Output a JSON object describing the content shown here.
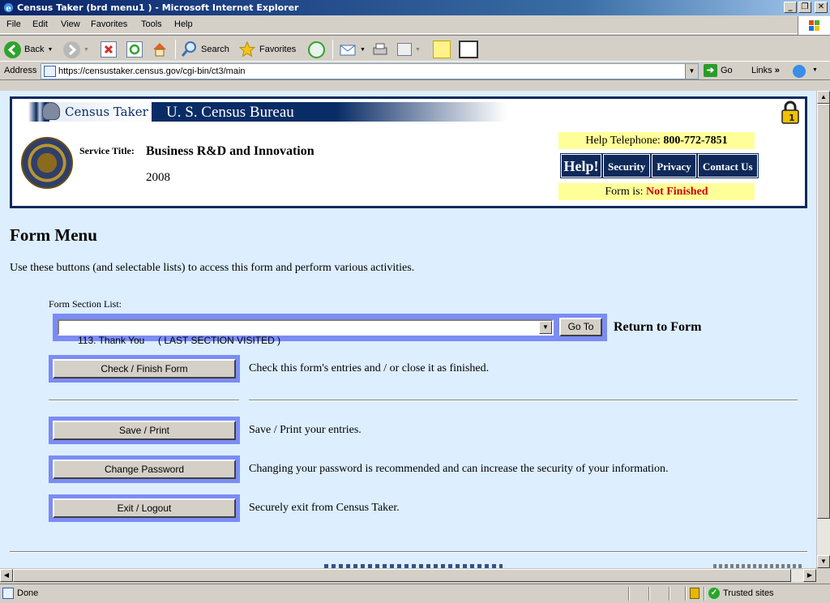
{
  "window": {
    "title": "Census Taker (brd menu1 ) - Microsoft Internet Explorer",
    "buttons": {
      "minimize": "_",
      "maximize": "❐",
      "close": "✕"
    }
  },
  "menubar": {
    "items": [
      {
        "label": "File"
      },
      {
        "label": "Edit"
      },
      {
        "label": "View"
      },
      {
        "label": "Favorites"
      },
      {
        "label": "Tools"
      },
      {
        "label": "Help"
      }
    ]
  },
  "toolbar": {
    "back_label": "Back",
    "search_label": "Search",
    "favorites_label": "Favorites",
    "icons": [
      "back-icon",
      "forward-icon",
      "stop-icon",
      "refresh-icon",
      "home-icon",
      "search-icon",
      "favorites-icon",
      "history-icon",
      "mail-icon",
      "print-icon",
      "edit-icon",
      "discuss-icon",
      "messenger-icon"
    ]
  },
  "addressbar": {
    "label": "Address",
    "url": "https://censustaker.census.gov/cgi-bin/ct3/main",
    "go_label": "Go",
    "links_label": "Links",
    "links_chevron": "»"
  },
  "banner": {
    "app_name": "Census Taker",
    "agency": "U. S. Census Bureau",
    "service_title_label": "Service Title:",
    "service_title": "Business R&D and Innovation",
    "year": "2008",
    "help_tel_label": "Help Telephone:",
    "help_tel_number": "800-772-7851",
    "nav": {
      "help": "Help!",
      "security": "Security",
      "privacy": "Privacy",
      "contact": "Contact Us"
    },
    "form_status_label": "Form is:",
    "form_status": "Not Finished",
    "colors": {
      "navy": "#0f2a5a",
      "highlight": "#ffff99",
      "status_red": "#cc0000"
    }
  },
  "main": {
    "heading": "Form Menu",
    "intro": "Use these buttons (and selectable lists) to access this form and perform various activities.",
    "section_list_label": "Form Section List:",
    "section_selected": "113. Thank You     ( LAST SECTION VISITED )",
    "goto_label": "Go To",
    "return_label": "Return to Form",
    "actions": [
      {
        "label": "Check / Finish Form",
        "desc": "Check this form's entries and / or close it as finished."
      },
      {
        "label": "Save / Print",
        "desc": "Save / Print your entries."
      },
      {
        "label": "Change Password",
        "desc": "Changing your password is recommended and can increase the security of your information."
      },
      {
        "label": "Exit / Logout",
        "desc": "Securely exit from Census Taker."
      }
    ]
  },
  "statusbar": {
    "text": "Done",
    "zone": "Trusted sites"
  }
}
